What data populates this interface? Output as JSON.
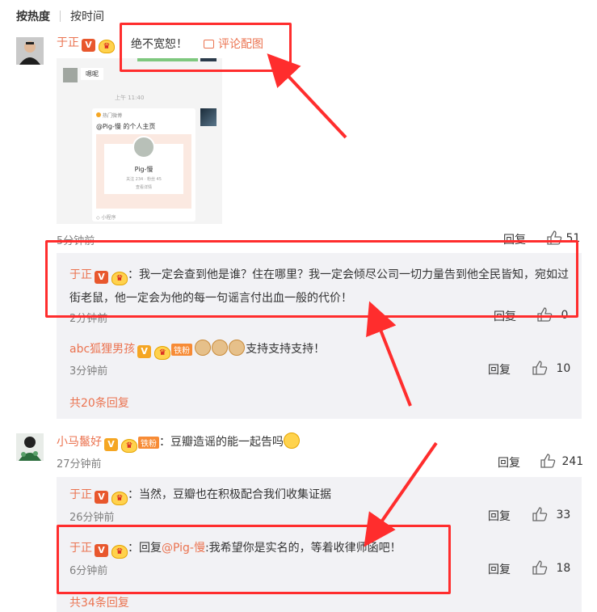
{
  "sort": {
    "hot": "按热度",
    "time": "按时间"
  },
  "c1": {
    "user": "于正",
    "v": "V",
    "image_label": "评论配图",
    "screenshot": {
      "chat_text": "嗯呢",
      "time_text": "上午 11:40",
      "card_header": "热门微博",
      "card_title": "@Pig-慢 的个人主页",
      "profile_name": "Pig-慢",
      "stats": "关注 234 · 粉丝 45",
      "card_link": "查看详情",
      "footer": "◇ 小程序"
    },
    "time": "5分钟前",
    "reply": "回复",
    "likes": "51",
    "r1": {
      "user": "于正",
      "text": "：我一定会查到他是谁？住在哪里？我一定会倾尽公司一切力量告到他全民皆知，宛如过街老鼠，他一定会为他的每一句谣言付出血一般的代价！",
      "time": "2分钟前",
      "reply": "回复",
      "likes": "0"
    },
    "r2": {
      "user": "abc狐狸男孩",
      "fan": "铁粉",
      "text": "支持支持支持！",
      "time": "3分钟前",
      "reply": "回复",
      "likes": "10"
    },
    "more": "共20条回复"
  },
  "overlay_text": "绝不宽恕！",
  "c2": {
    "user": "小马鬣好",
    "fan": "铁粉",
    "text": "：豆瓣造谣的能一起告吗",
    "time": "27分钟前",
    "reply": "回复",
    "likes": "241",
    "r1": {
      "user": "于正",
      "text": "：当然，豆瓣也在积极配合我们收集证据",
      "time": "26分钟前",
      "reply": "回复",
      "likes": "33"
    },
    "r2": {
      "user": "于正",
      "prefix": "：回复",
      "mention": "@Pig-慢",
      "text": ":我希望你是实名的，等着收律师函吧！",
      "time": "6分钟前",
      "reply": "回复",
      "likes": "18"
    },
    "more": "共34条回复"
  },
  "colors": {
    "accent": "#eb7350",
    "annotation": "#ff2d2d",
    "reply_bg": "#f2f2f5"
  }
}
